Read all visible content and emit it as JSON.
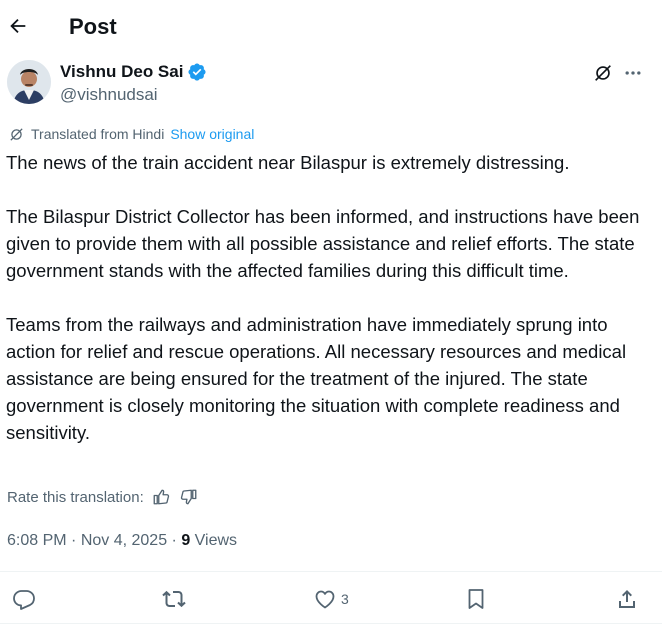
{
  "header": {
    "title": "Post"
  },
  "author": {
    "name": "Vishnu Deo Sai",
    "handle": "@vishnudsai"
  },
  "translation": {
    "label": "Translated from Hindi",
    "show_original": "Show original"
  },
  "post": {
    "paragraphs": [
      "The news of the train accident near Bilaspur is extremely distressing.",
      "The Bilaspur District Collector has been informed, and instructions have been given to provide them with all possible assistance and relief efforts. The state government stands with the affected families during this difficult time.",
      "Teams from the railways and administration have immediately sprung into action for relief and rescue operations. All necessary resources and medical assistance are being ensured for the treatment of the injured. The state government is closely monitoring the situation with complete readiness and sensitivity."
    ]
  },
  "rate": {
    "label": "Rate this translation:"
  },
  "meta": {
    "time": "6:08 PM",
    "sep": " · ",
    "date": "Nov 4, 2025",
    "sep2": " · ",
    "views_count": "9",
    "views_label": " Views"
  },
  "actions": {
    "likes": "3"
  },
  "colors": {
    "accent": "#1d9bf0",
    "muted": "#536471",
    "text": "#0f1419"
  }
}
